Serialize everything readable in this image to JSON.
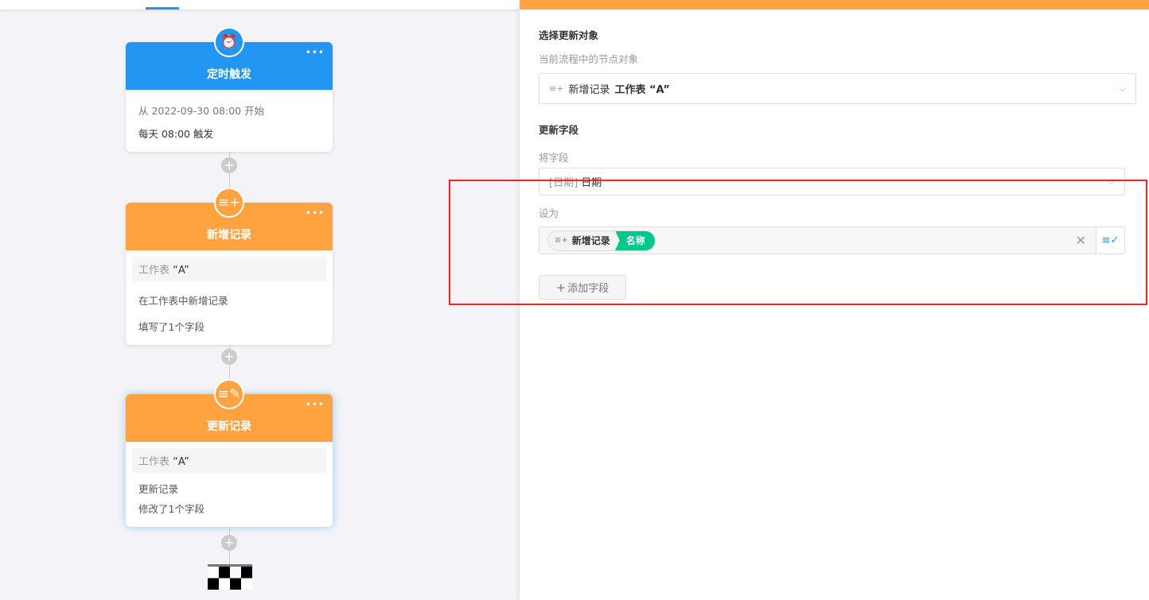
{
  "flow": {
    "nodes": [
      {
        "title": "定时触发",
        "icon": "alarm-clock-icon",
        "color": "#2196f3",
        "lines": [
          "从 2022-09-30 08:00 开始",
          "每天 08:00 触发"
        ]
      },
      {
        "title": "新增记录",
        "icon": "add-record-icon",
        "color": "#ffa340",
        "sheet_prefix": "工作表",
        "sheet_name": "“A”",
        "lines": [
          "在工作表中新增记录",
          "填写了1个字段"
        ]
      },
      {
        "title": "更新记录",
        "icon": "edit-record-icon",
        "color": "#ffa340",
        "sheet_prefix": "工作表",
        "sheet_name": "“A”",
        "lines": [
          "更新记录",
          "修改了1个字段"
        ]
      }
    ],
    "more": "•••",
    "plus": "+"
  },
  "panel": {
    "select_target_label": "选择更新对象",
    "select_target_hint": "当前流程中的节点对象",
    "target_node": "新增记录",
    "target_sheet": "工作表 “A”",
    "update_fields_label": "更新字段",
    "field_label": "将字段",
    "field_type": "[日期]",
    "field_name": "日期",
    "set_to_label": "设为",
    "value_node": "新增记录",
    "value_field": "名称",
    "add_field_button": "添加字段"
  },
  "colors": {
    "accent": "#2196f3",
    "orange": "#ffa340",
    "green": "#00c78a",
    "highlight": "#f5221b"
  }
}
